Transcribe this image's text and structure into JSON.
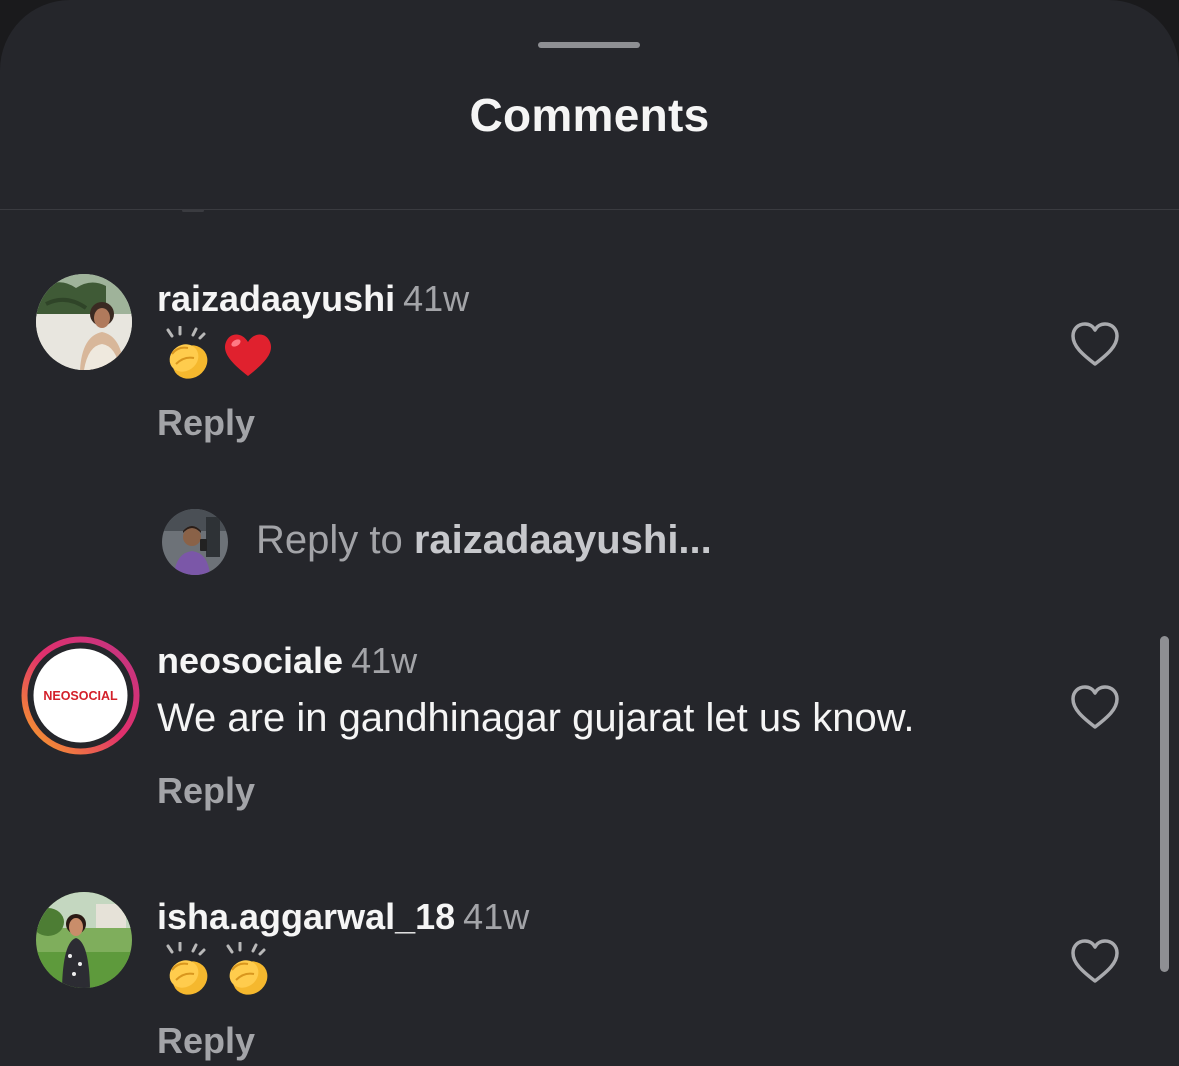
{
  "sheet": {
    "title": "Comments"
  },
  "comments": [
    {
      "username": "raizadaayushi",
      "time": "41w",
      "text": "",
      "emojis": [
        "👏",
        "❤️"
      ],
      "reply_label": "Reply"
    },
    {
      "username": "neosociale",
      "time": "41w",
      "text": "We are in gandhinagar gujarat let us know.",
      "emojis": [],
      "reply_label": "Reply",
      "avatar_logo": "NEOSOCIAL"
    },
    {
      "username": "isha.aggarwal_18",
      "time": "41w",
      "text": "",
      "emojis": [
        "👏",
        "👏"
      ],
      "reply_label": "Reply"
    }
  ],
  "composer": {
    "prefix": "Reply to ",
    "target": "raizadaayushi..."
  },
  "icons": {
    "like": "heart-outline-icon"
  },
  "colors": {
    "sheet_bg": "#25262b",
    "text_primary": "#f5f5f5",
    "text_secondary": "#a3a4a8",
    "story_ring_start": "#f9a825",
    "story_ring_end": "#c13584"
  }
}
